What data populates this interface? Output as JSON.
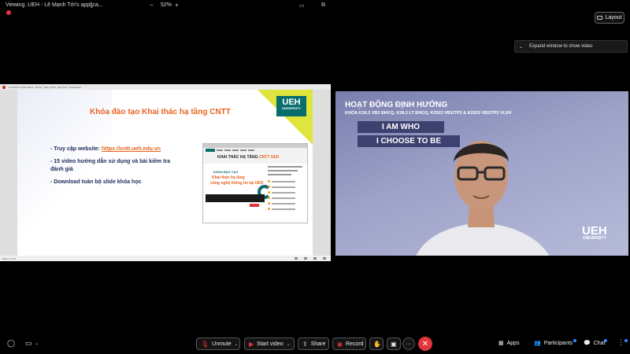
{
  "top": {
    "title": "Viewing .UEH - Lê Mạnh Tới's applica...",
    "zoom_minus": "−",
    "zoom_value": "52%",
    "zoom_plus": "+",
    "layout_label": "Layout",
    "expand_label": "Expand window to show video"
  },
  "ppt": {
    "title": "PowerPoint Slide Show - [GTHT_UEH_CNTT_HR.pptx] - PowerPoint",
    "status": "Slide 1 of 15"
  },
  "slide": {
    "title": "Khóa đào tạo Khai thác hạ tầng CNTT",
    "logo_big": "UEH",
    "logo_small": "UNIVERSITY",
    "items": [
      {
        "prefix": "- Truy cập website: ",
        "link": "https://cntt.ueh.edu.vn"
      },
      {
        "prefix": "- 15 video hướng dẫn sử dụng và bài kiểm tra đánh giá",
        "link": ""
      },
      {
        "prefix": "- Download toàn bộ slide khóa học",
        "link": ""
      }
    ],
    "thumb": {
      "headline": "KHAI THÁC HẠ TẦNG ",
      "headline_accent": "CNTT UEH",
      "card_label": "KHÓA ĐÀO TẠO",
      "card_line1": "Khai thác hạ tầng",
      "card_line2": "công nghệ thông tin tại UEH"
    }
  },
  "video": {
    "title": "HOẠT ĐỘNG ĐỊNH HƯỚNG",
    "subtitle": "KHÓA K26.2 VB2 ĐHCQ, K38.2 LT ĐHCQ, K2023 VB1/TP3 & K2023 VB2/TP3 VLVH",
    "banner1": "I AM WHO",
    "banner2": "I CHOOSE TO BE",
    "logo_big": "UEH",
    "logo_small": "UNIVERSITY"
  },
  "toolbar": {
    "unmute": "Unmute",
    "start_video": "Start video",
    "share": "Share",
    "record": "Record",
    "more": "···",
    "apps": "Apps",
    "participants": "Participants",
    "chat": "Chat"
  },
  "colors": {
    "accent_orange": "#e8641f",
    "ueh_teal": "#0a6d6d",
    "end_red": "#e2353b",
    "notify_blue": "#2d8cff"
  }
}
